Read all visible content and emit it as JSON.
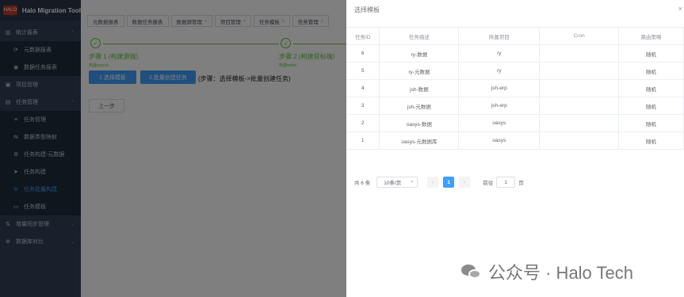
{
  "app": {
    "title": "Halo Migration Tool",
    "logo_text": "HALO"
  },
  "sidebar": {
    "items": [
      {
        "label": "统计报表",
        "icon": "chart-icon",
        "arrow": "⌃"
      },
      {
        "label": "元数据报表",
        "icon": "refresh-icon",
        "sub": true
      },
      {
        "label": "数据任务报表",
        "icon": "dashboard-icon",
        "sub": true
      },
      {
        "label": "项目管理",
        "icon": "folder-icon"
      },
      {
        "label": "任务管理",
        "icon": "task-icon",
        "arrow": "⌃"
      },
      {
        "label": "任务管理",
        "icon": "list-icon",
        "sub": true
      },
      {
        "label": "数据类型映射",
        "icon": "mapping-icon",
        "sub": true
      },
      {
        "label": "任务构建-元数据",
        "icon": "gear-icon",
        "sub": true
      },
      {
        "label": "任务构建",
        "icon": "send-icon",
        "sub": true
      },
      {
        "label": "任务批量构建",
        "icon": "batch-icon",
        "sub": true,
        "active": true
      },
      {
        "label": "任务模板",
        "icon": "template-icon",
        "sub": true
      },
      {
        "label": "增量同步管理",
        "icon": "sync-icon",
        "arrow": "⌄"
      },
      {
        "label": "数据库对比",
        "icon": "compare-icon",
        "arrow": "⌄"
      }
    ]
  },
  "tags": [
    {
      "label": "元数据报表"
    },
    {
      "label": "数据任务报表"
    },
    {
      "label": "数据源管理",
      "caret": "×"
    },
    {
      "label": "项目管理",
      "caret": "×"
    },
    {
      "label": "任务模板",
      "caret": "×"
    },
    {
      "label": "任务管理",
      "caret": "×"
    }
  ],
  "steps": {
    "step1_title": "步骤 1 (构建源端)",
    "step1_desc": "构建source",
    "step2_title": "步骤 2 (构建目标端)",
    "step2_desc": "构建writer",
    "check": "✓"
  },
  "actions": {
    "select_template": "1.选择模板",
    "batch_create": "2.批量创建任务",
    "help": "(步骤：选择模板->批量创建任务)",
    "prev": "上一步"
  },
  "drawer": {
    "title": "选择模板",
    "close": "×",
    "columns": [
      "任务ID",
      "任务描述",
      "所属项目",
      "Cron",
      "路由策略"
    ],
    "rows": [
      {
        "id": "6",
        "desc": "ry-数据",
        "project": "ry",
        "cron": "",
        "route": "随机"
      },
      {
        "id": "5",
        "desc": "ry-元数据",
        "project": "ry",
        "cron": "",
        "route": "随机"
      },
      {
        "id": "4",
        "desc": "jsh-数据",
        "project": "jsh-erp",
        "cron": "",
        "route": "随机"
      },
      {
        "id": "3",
        "desc": "jsh-元数据",
        "project": "jsh-erp",
        "cron": "",
        "route": "随机"
      },
      {
        "id": "2",
        "desc": "oasys-数据",
        "project": "oasys",
        "cron": "",
        "route": "随机"
      },
      {
        "id": "1",
        "desc": "oasys-元数据库",
        "project": "oasys",
        "cron": "",
        "route": "随机"
      }
    ],
    "pager": {
      "total": "共 6 条",
      "page_size": "10条/页",
      "prev": "‹",
      "current": "1",
      "next": "›",
      "goto_label": "前往",
      "goto_value": "1",
      "page_unit": "页"
    }
  },
  "watermark": {
    "text": "公众号 · Halo Tech"
  }
}
